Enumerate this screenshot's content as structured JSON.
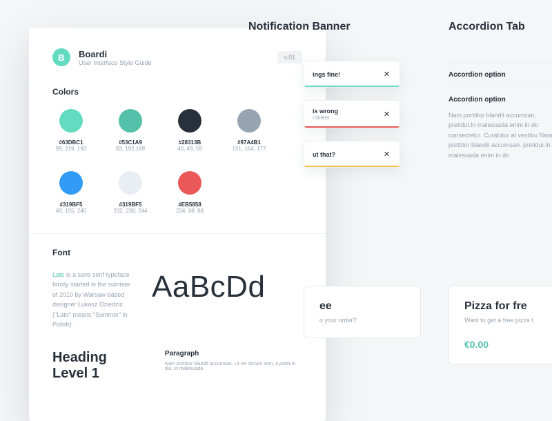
{
  "header": {
    "logo_letter": "B",
    "title": "Boardi",
    "subtitle": "User Interface Style Guide",
    "version": "v.01"
  },
  "sections": {
    "colors_heading": "Colors",
    "font_heading": "Font"
  },
  "colors": [
    {
      "hex": "#63DBC1",
      "rgb": "99, 219, 193"
    },
    {
      "hex": "#53C1A9",
      "rgb": "83, 192,169"
    },
    {
      "hex": "#28313B",
      "rgb": "40, 49, 59"
    },
    {
      "hex": "#97A4B1",
      "rgb": "151, 164, 177"
    },
    {
      "hex": "#319BF5",
      "rgb": "49, 155, 245"
    },
    {
      "hex": "#319BF5",
      "rgb": "232, 238, 244",
      "display": "#E8EEF4"
    },
    {
      "hex": "#EB5858",
      "rgb": "234, 88, 88"
    }
  ],
  "font": {
    "link_word": "Lato",
    "blurb": " is a sans serif typeface family started in the summer of 2010 by Warsaw-based designer Łukasz Dziedzic (\"Lato\" means \"Summer\" in Polish).",
    "sample": "AaBcDd",
    "h1": "Heading Level 1",
    "para_label": "Paragraph",
    "para_text": "Nam porttitor blandit accumsan. Ut vel dictum sem, a pretium dui. In malesuada"
  },
  "right": {
    "notif_title": "Notification Banner",
    "acc_title": "Accordion Tab"
  },
  "notifications": [
    {
      "line1": "ings fine!",
      "line2": "",
      "bar": "#63DBC1"
    },
    {
      "line1": "is wrong",
      "line2": "roblem",
      "bar": "#EB5858"
    },
    {
      "line1": "ut that?",
      "line2": "",
      "bar": "#F6C244"
    }
  ],
  "accordion": [
    {
      "label": "Accordion option",
      "body": ""
    },
    {
      "label": "Accordion option",
      "body": "Nam porttitor blandit accumsan. pretidui.In malesuada enim in do consectetur. Curabitur at vestibu\n\nNam porttitor blandit accumsan. pretidui.In malesuada enim in do"
    }
  ],
  "promos": [
    {
      "title": "ee",
      "sub": "o your order?",
      "price": ""
    },
    {
      "title": "Pizza for fre",
      "sub": "Want to get a free pizza t",
      "price": "€0.00"
    }
  ]
}
